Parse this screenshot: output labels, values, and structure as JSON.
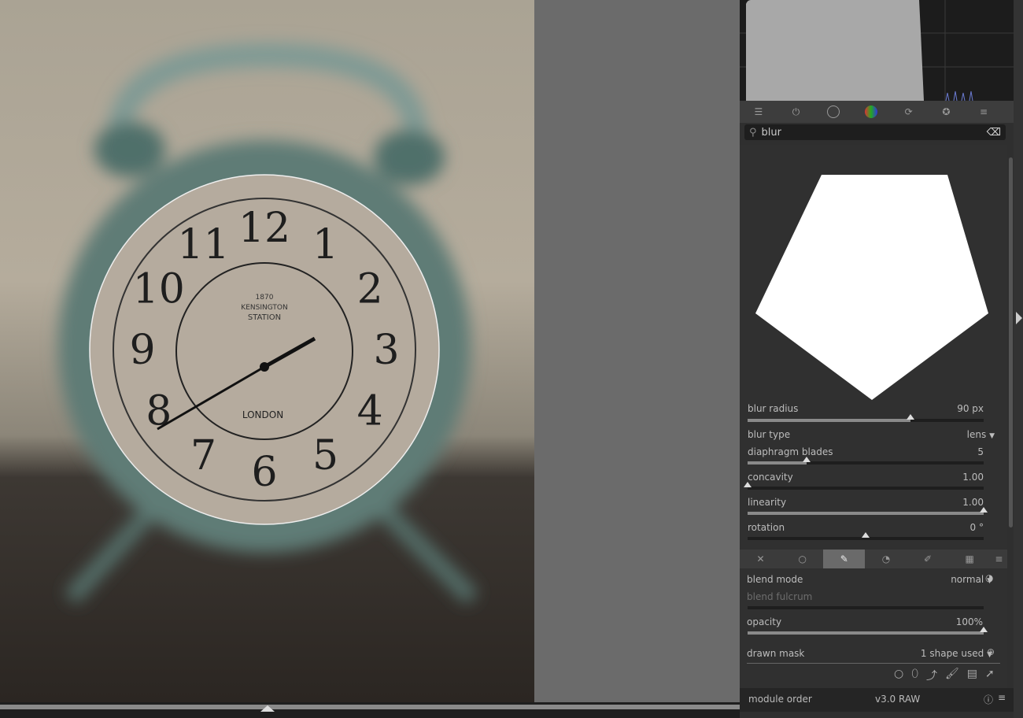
{
  "photo": {
    "clock_numbers": [
      "12",
      "1",
      "2",
      "3",
      "4",
      "5",
      "6",
      "7",
      "8",
      "9",
      "10",
      "11"
    ],
    "face_text": [
      "1870",
      "KENSINGTON",
      "STATION",
      "LONDON"
    ]
  },
  "toolbar": {
    "icons": [
      "presets-icon",
      "power-icon",
      "circle-icon",
      "color-wheel-icon",
      "refresh-icon",
      "favorite-icon",
      "menu-icon"
    ]
  },
  "search": {
    "value": "blur"
  },
  "module": {
    "blur_radius": {
      "label": "blur radius",
      "value": "90 px",
      "fraction": 0.69
    },
    "blur_type": {
      "label": "blur type",
      "value": "lens"
    },
    "diaphragm_blades": {
      "label": "diaphragm blades",
      "value": "5",
      "fraction": 0.25
    },
    "concavity": {
      "label": "concavity",
      "value": "1.00",
      "fraction": 0.0
    },
    "linearity": {
      "label": "linearity",
      "value": "1.00",
      "fraction": 1.0
    },
    "rotation": {
      "label": "rotation",
      "value": "0 °",
      "fraction": 0.5
    }
  },
  "blend": {
    "mode_label": "blend mode",
    "mode_value": "normal",
    "fulcrum_label": "blend fulcrum",
    "opacity_label": "opacity",
    "opacity_value": "100%",
    "opacity_fraction": 1.0,
    "mask_label": "drawn mask",
    "mask_value": "1 shape used"
  },
  "footer": {
    "label": "module order",
    "value": "v3.0 RAW"
  }
}
